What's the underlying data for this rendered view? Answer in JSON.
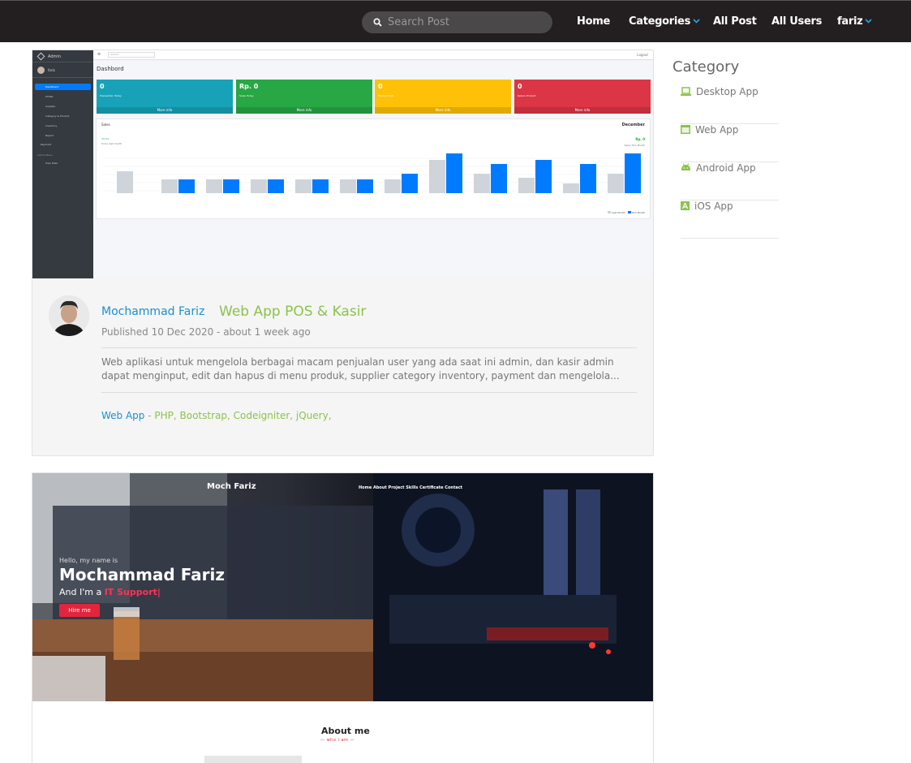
{
  "navbar": {
    "search_placeholder": "Search Post",
    "links": [
      "Home",
      "Categories",
      "All Post",
      "All Users",
      "fariz"
    ]
  },
  "post1": {
    "screenshot": {
      "brand": "Admin",
      "user": "fariz",
      "menu": [
        "Dashboard",
        "Profile",
        "Supplier",
        "Category & Product",
        "Inventory",
        "Report",
        "Payment",
        "Admin Menu",
        "User Data"
      ],
      "page_title": "Dashbord",
      "search_placeholder": "Search",
      "logout": "Logout",
      "boxes": [
        {
          "value": "0",
          "label": "Transaction Today",
          "footer": "More info",
          "color": "#17a2b8"
        },
        {
          "value": "Rp. 0",
          "label": "Sales Today",
          "footer": "More info",
          "color": "#28a745"
        },
        {
          "value": "0",
          "label": "Product Sold",
          "footer": "More info",
          "color": "#ffc107"
        },
        {
          "value": "0",
          "label": "Return Product",
          "footer": "More info",
          "color": "#dc3545"
        }
      ],
      "chart_title": "Sales",
      "chart_month": "December",
      "chart_change": "33.1%",
      "chart_since": "Since last month",
      "chart_total": "Rp. 0",
      "chart_total_label": "Sales This Month",
      "legend": [
        "Last Month",
        "This Month"
      ]
    },
    "author": "Mochammad Fariz",
    "title": "Web App POS & Kasir",
    "published": "Published 10 Dec 2020 - about 1 week ago",
    "excerpt": "Web aplikasi untuk mengelola berbagai macam penjualan user yang ada saat ini admin, dan kasir admin dapat menginput, edit dan hapus di menu produk, supplier category inventory, payment dan mengelola...",
    "category": "Web App",
    "separator": " - ",
    "tags": "PHP, Bootstrap, Codeigniter, jQuery,"
  },
  "post2": {
    "logo": "Moch Fariz",
    "nav": "Home   About   Project   Skills   Certificate   Contact",
    "hello": "Hello, my name is",
    "name": "Mochammad Fariz",
    "sub_prefix": "And I'm a ",
    "role": "IT Support|",
    "button": "Hire me",
    "about_title": "About me",
    "about_sub": "who i am"
  },
  "sidebar": {
    "heading": "Category",
    "items": [
      {
        "label": "Desktop App",
        "icon": "laptop-icon"
      },
      {
        "label": "Web App",
        "icon": "browser-icon"
      },
      {
        "label": "Android App",
        "icon": "android-icon"
      },
      {
        "label": "iOS App",
        "icon": "app-store-icon"
      }
    ]
  },
  "colors": {
    "navbar": "#231f20",
    "accent_blue": "#1c8fd0",
    "accent_green": "#8bc34a"
  }
}
